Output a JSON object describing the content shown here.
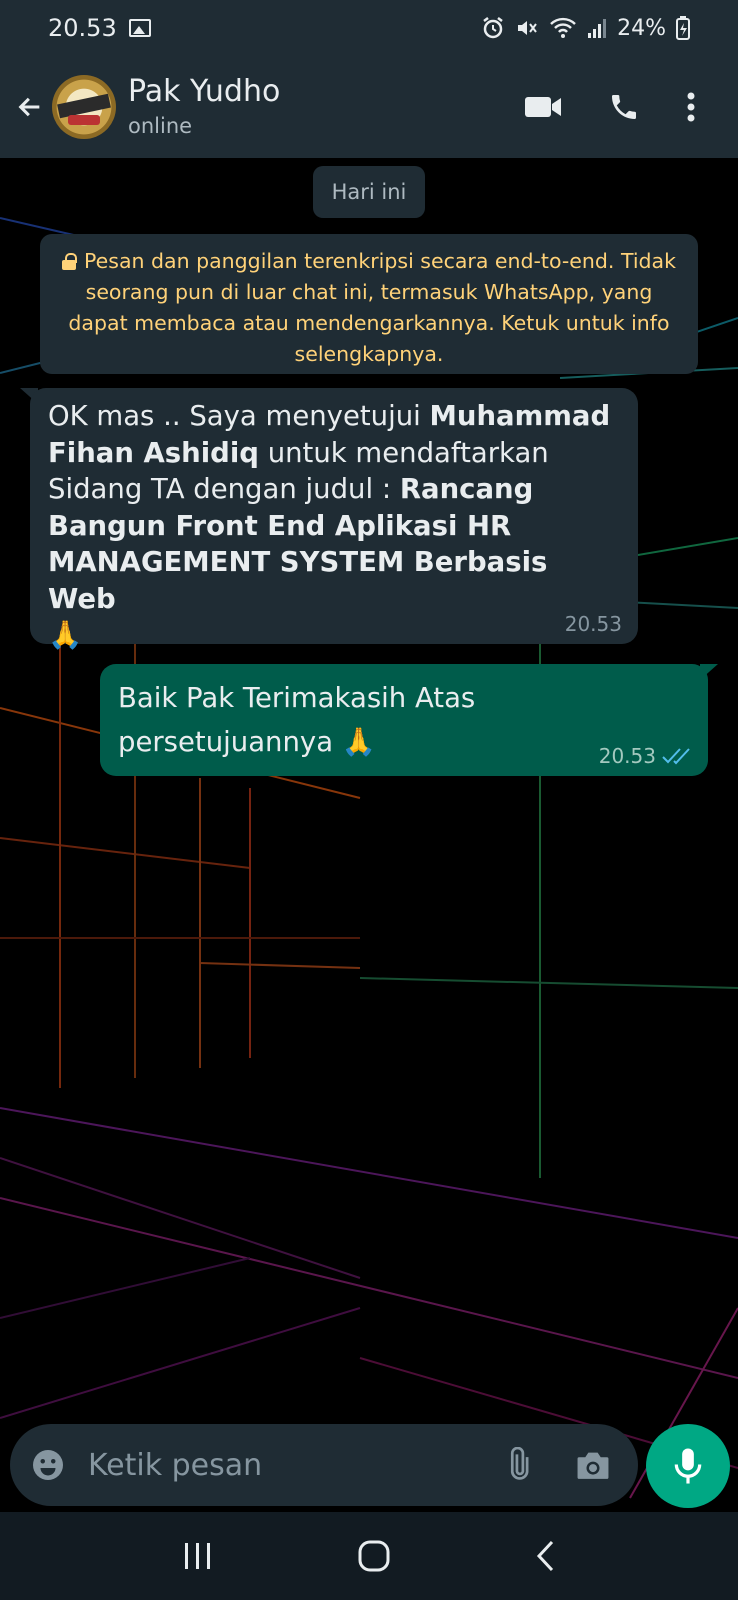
{
  "status_bar": {
    "time": "20.53",
    "battery": "24%"
  },
  "header": {
    "contact_name": "Pak Yudho",
    "contact_status": "online"
  },
  "chat": {
    "date_chip": "Hari ini",
    "encryption_notice": "Pesan dan panggilan terenkripsi secara end-to-end. Tidak seorang pun di luar chat ini, termasuk WhatsApp, yang dapat membaca atau mendengarkannya. Ketuk untuk info selengkapnya.",
    "incoming": {
      "part1": "OK mas .. Saya menyetujui ",
      "bold1": "Muhammad Fihan Ashidiq",
      "part2": " untuk mendaftarkan Sidang TA dengan judul : ",
      "bold2": "Rancang Bangun Front End Aplikasi HR MANAGEMENT SYSTEM Berbasis Web",
      "emoji": "🙏",
      "time": "20.53"
    },
    "outgoing": {
      "text": "Baik Pak Terimakasih Atas persetujuannya",
      "emoji": "🙏",
      "time": "20.53",
      "read_status": "read"
    }
  },
  "composer": {
    "placeholder": "Ketik pesan"
  },
  "colors": {
    "header_bg": "#1f2c34",
    "incoming_bubble": "#1f2c34",
    "outgoing_bubble": "#005c4b",
    "accent": "#00a884",
    "notice_text": "#ffd279",
    "read_ticks": "#53bdeb"
  },
  "icons": {
    "status_bar": [
      "gallery-icon",
      "alarm-icon",
      "mute-icon",
      "wifi-icon",
      "signal-icon",
      "battery-icon"
    ],
    "header": [
      "back-arrow-icon",
      "video-call-icon",
      "voice-call-icon",
      "more-options-icon"
    ],
    "composer": [
      "emoji-icon",
      "attach-icon",
      "camera-icon",
      "mic-icon"
    ],
    "nav": [
      "recents-icon",
      "home-icon",
      "back-icon"
    ]
  }
}
